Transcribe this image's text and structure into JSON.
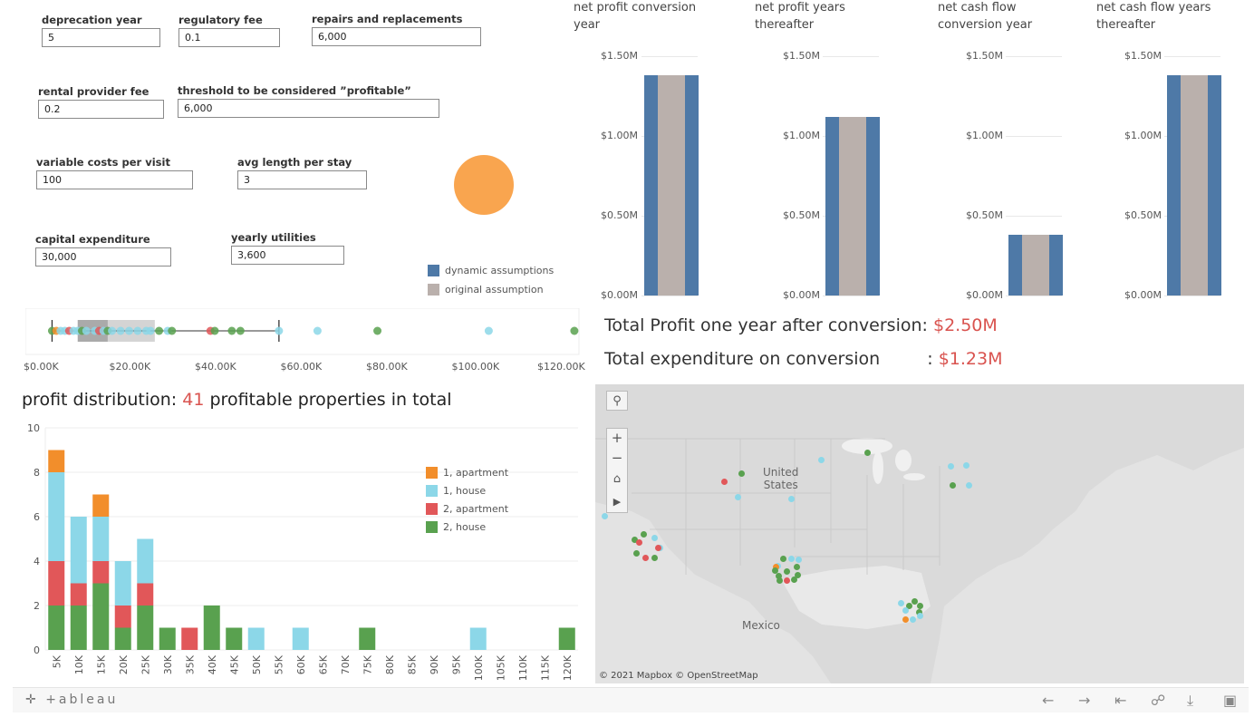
{
  "parameters": [
    {
      "label": "deprecation year",
      "value": "5"
    },
    {
      "label": "regulatory fee",
      "value": "0.1"
    },
    {
      "label": "repairs and replacements",
      "value": "6,000"
    },
    {
      "label": "rental provider fee",
      "value": "0.2"
    },
    {
      "label": "threshold to be considered ”profitable”",
      "value": "6,000"
    },
    {
      "label": "variable costs per visit",
      "value": "100"
    },
    {
      "label": "avg length per stay",
      "value": "3"
    },
    {
      "label": "capital expenditure",
      "value": "30,000"
    },
    {
      "label": "yearly utilities",
      "value": "3,600"
    }
  ],
  "colors": {
    "dynamic": "#4e79a7",
    "original": "#bab0ac",
    "orange_circle": "#f9a54f",
    "apartment1": "#f28e2b",
    "house1": "#8cd7e8",
    "apartment2": "#e15759",
    "house2": "#59a14f",
    "highlight": "#d9534f"
  },
  "legend_assumptions": [
    {
      "label": "dynamic assumptions",
      "color": "#4e79a7"
    },
    {
      "label": "original assumption",
      "color": "#bab0ac"
    }
  ],
  "small_multiples": [
    {
      "title_line1": "net profit conversion",
      "title_line2": "year",
      "value": 1.38
    },
    {
      "title_line1": "net profit years",
      "title_line2": "thereafter",
      "value": 1.12
    },
    {
      "title_line1": "net cash flow",
      "title_line2": "conversion year",
      "value": 0.38
    },
    {
      "title_line1": "net cash flow years",
      "title_line2": "thereafter",
      "value": 1.38
    }
  ],
  "small_multiple_ticks": [
    "$1.50M",
    "$1.00M",
    "$0.50M",
    "$0.00M"
  ],
  "totals": {
    "profit_label": "Total Profit one year after conversion:",
    "profit_value": "$2.50M",
    "expenditure_label": "Total expenditure on conversion",
    "expenditure_sep": ":",
    "expenditure_value": "$1.23M"
  },
  "boxplot": {
    "ticks": [
      "$0.00K",
      "$20.00K",
      "$40.00K",
      "$60.00K",
      "$80.00K",
      "$100.00K",
      "$120.00K"
    ],
    "points": [
      {
        "v": 2,
        "c": "house2"
      },
      {
        "v": 3,
        "c": "apartment1"
      },
      {
        "v": 4,
        "c": "house1"
      },
      {
        "v": 5,
        "c": "house1"
      },
      {
        "v": 6,
        "c": "apartment2"
      },
      {
        "v": 7,
        "c": "house1"
      },
      {
        "v": 8,
        "c": "house1"
      },
      {
        "v": 9,
        "c": "house2"
      },
      {
        "v": 10,
        "c": "house1"
      },
      {
        "v": 12,
        "c": "house1"
      },
      {
        "v": 13,
        "c": "apartment2"
      },
      {
        "v": 14,
        "c": "house1"
      },
      {
        "v": 15,
        "c": "house2"
      },
      {
        "v": 16,
        "c": "house1"
      },
      {
        "v": 18,
        "c": "house1"
      },
      {
        "v": 20,
        "c": "house1"
      },
      {
        "v": 22,
        "c": "house1"
      },
      {
        "v": 24,
        "c": "house1"
      },
      {
        "v": 25,
        "c": "house1"
      },
      {
        "v": 27,
        "c": "house2"
      },
      {
        "v": 29,
        "c": "house1"
      },
      {
        "v": 30,
        "c": "house2"
      },
      {
        "v": 39,
        "c": "apartment2"
      },
      {
        "v": 40,
        "c": "house2"
      },
      {
        "v": 44,
        "c": "house2"
      },
      {
        "v": 46,
        "c": "house2"
      },
      {
        "v": 55,
        "c": "house1"
      },
      {
        "v": 64,
        "c": "house1"
      },
      {
        "v": 78,
        "c": "house2"
      },
      {
        "v": 104,
        "c": "house1"
      },
      {
        "v": 124,
        "c": "house2"
      }
    ],
    "whisker_low": 2,
    "q1": 8,
    "median": 15,
    "q3": 26,
    "whisker_high": 55
  },
  "profit_distribution": {
    "title_prefix": "profit distribution:",
    "count": "41",
    "title_suffix": "profitable properties in total"
  },
  "legend_types": [
    {
      "label": "1, apartment",
      "key": "apartment1"
    },
    {
      "label": "1, house",
      "key": "house1"
    },
    {
      "label": "2, apartment",
      "key": "apartment2"
    },
    {
      "label": "2, house",
      "key": "house2"
    }
  ],
  "chart_data": {
    "type": "bar",
    "stacked": true,
    "categories": [
      "5K",
      "10K",
      "15K",
      "20K",
      "25K",
      "30K",
      "35K",
      "40K",
      "45K",
      "50K",
      "55K",
      "60K",
      "65K",
      "70K",
      "75K",
      "80K",
      "85K",
      "90K",
      "95K",
      "100K",
      "105K",
      "110K",
      "115K",
      "120K"
    ],
    "series": [
      {
        "name": "2, house",
        "key": "house2",
        "values": [
          2,
          2,
          3,
          1,
          2,
          1,
          0,
          2,
          1,
          0,
          0,
          0,
          0,
          0,
          1,
          0,
          0,
          0,
          0,
          0,
          0,
          0,
          0,
          1
        ]
      },
      {
        "name": "2, apartment",
        "key": "apartment2",
        "values": [
          2,
          1,
          1,
          1,
          1,
          0,
          1,
          0,
          0,
          0,
          0,
          0,
          0,
          0,
          0,
          0,
          0,
          0,
          0,
          0,
          0,
          0,
          0,
          0
        ]
      },
      {
        "name": "1, house",
        "key": "house1",
        "values": [
          4,
          3,
          2,
          2,
          2,
          0,
          0,
          0,
          0,
          1,
          0,
          1,
          0,
          0,
          0,
          0,
          0,
          0,
          0,
          1,
          0,
          0,
          0,
          0
        ]
      },
      {
        "name": "1, apartment",
        "key": "apartment1",
        "values": [
          1,
          0,
          1,
          0,
          0,
          0,
          0,
          0,
          0,
          0,
          0,
          0,
          0,
          0,
          0,
          0,
          0,
          0,
          0,
          0,
          0,
          0,
          0,
          0
        ]
      }
    ],
    "yticks": [
      "10",
      "8",
      "6",
      "4",
      "2",
      "0"
    ],
    "ylim": [
      0,
      10
    ]
  },
  "map": {
    "labels": {
      "country1": "United",
      "country2": "States",
      "mexico": "Mexico"
    },
    "attribution": "© 2021 Mapbox  © OpenStreetMap",
    "points": [
      {
        "x": 0.226,
        "y": 0.298,
        "c": "house2"
      },
      {
        "x": 0.199,
        "y": 0.326,
        "c": "apartment2"
      },
      {
        "x": 0.22,
        "y": 0.377,
        "c": "house1"
      },
      {
        "x": 0.348,
        "y": 0.254,
        "c": "house1"
      },
      {
        "x": 0.303,
        "y": 0.384,
        "c": "house1"
      },
      {
        "x": 0.42,
        "y": 0.229,
        "c": "house2"
      },
      {
        "x": 0.548,
        "y": 0.273,
        "c": "house1"
      },
      {
        "x": 0.572,
        "y": 0.272,
        "c": "house1"
      },
      {
        "x": 0.551,
        "y": 0.338,
        "c": "house2"
      },
      {
        "x": 0.576,
        "y": 0.339,
        "c": "house1"
      },
      {
        "x": 0.014,
        "y": 0.44,
        "c": "house1"
      },
      {
        "x": 0.075,
        "y": 0.5,
        "c": "house2"
      },
      {
        "x": 0.061,
        "y": 0.52,
        "c": "house2"
      },
      {
        "x": 0.091,
        "y": 0.515,
        "c": "house1"
      },
      {
        "x": 0.068,
        "y": 0.53,
        "c": "apartment2"
      },
      {
        "x": 0.1,
        "y": 0.548,
        "c": "house1"
      },
      {
        "x": 0.097,
        "y": 0.548,
        "c": "apartment2"
      },
      {
        "x": 0.064,
        "y": 0.565,
        "c": "house2"
      },
      {
        "x": 0.077,
        "y": 0.58,
        "c": "apartment2"
      },
      {
        "x": 0.091,
        "y": 0.58,
        "c": "house2"
      },
      {
        "x": 0.29,
        "y": 0.582,
        "c": "house2"
      },
      {
        "x": 0.302,
        "y": 0.582,
        "c": "house1"
      },
      {
        "x": 0.314,
        "y": 0.587,
        "c": "house1"
      },
      {
        "x": 0.282,
        "y": 0.608,
        "c": "house1"
      },
      {
        "x": 0.279,
        "y": 0.61,
        "c": "apartment1"
      },
      {
        "x": 0.277,
        "y": 0.624,
        "c": "house2"
      },
      {
        "x": 0.295,
        "y": 0.625,
        "c": "house2"
      },
      {
        "x": 0.311,
        "y": 0.61,
        "c": "house2"
      },
      {
        "x": 0.312,
        "y": 0.637,
        "c": "house2"
      },
      {
        "x": 0.283,
        "y": 0.64,
        "c": "house2"
      },
      {
        "x": 0.295,
        "y": 0.655,
        "c": "apartment2"
      },
      {
        "x": 0.307,
        "y": 0.653,
        "c": "house2"
      },
      {
        "x": 0.284,
        "y": 0.657,
        "c": "house2"
      },
      {
        "x": 0.471,
        "y": 0.733,
        "c": "house1"
      },
      {
        "x": 0.484,
        "y": 0.74,
        "c": "house2"
      },
      {
        "x": 0.493,
        "y": 0.727,
        "c": "house2"
      },
      {
        "x": 0.5,
        "y": 0.74,
        "c": "house2"
      },
      {
        "x": 0.478,
        "y": 0.757,
        "c": "house1"
      },
      {
        "x": 0.499,
        "y": 0.762,
        "c": "house2"
      },
      {
        "x": 0.478,
        "y": 0.787,
        "c": "apartment1"
      },
      {
        "x": 0.49,
        "y": 0.787,
        "c": "house1"
      },
      {
        "x": 0.5,
        "y": 0.775,
        "c": "house1"
      }
    ]
  },
  "footer": {
    "brand": "+ableau"
  }
}
